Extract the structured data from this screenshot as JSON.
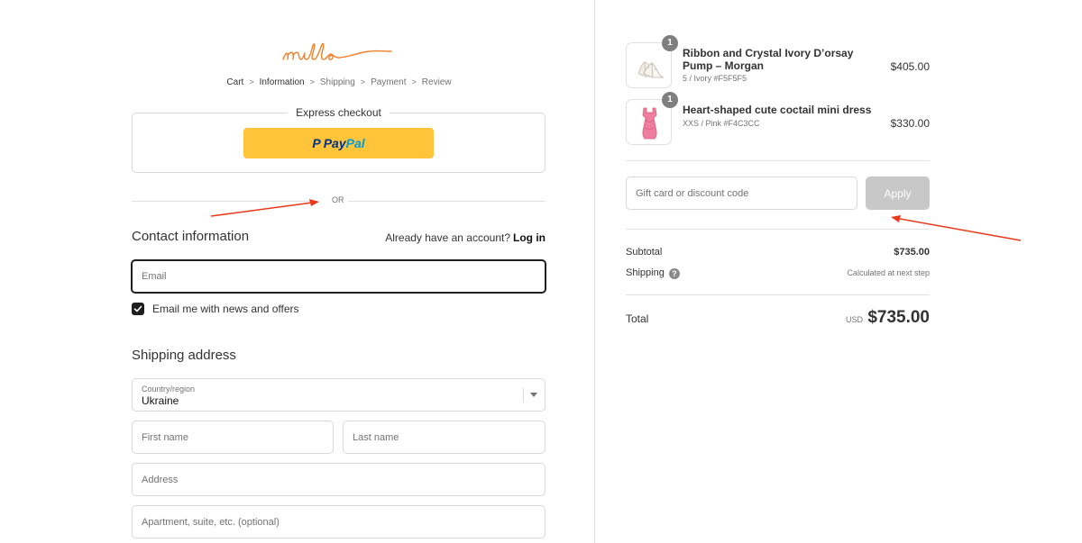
{
  "logo": {
    "text": "milla"
  },
  "breadcrumb": {
    "items": [
      "Cart",
      "Information",
      "Shipping",
      "Payment",
      "Review"
    ],
    "separator": ">"
  },
  "express": {
    "title": "Express checkout",
    "paypal": {
      "p": "P",
      "pay": "Pay",
      "pal": "Pal",
      "color": "#ffc439"
    }
  },
  "divider": {
    "text": "OR"
  },
  "contact": {
    "title": "Contact information",
    "account_prompt": "Already have an account?",
    "login_label": "Log in",
    "email_placeholder": "Email",
    "newsletter_label": "Email me with news and offers",
    "newsletter_checked": true
  },
  "shipping": {
    "title": "Shipping address",
    "country_label": "Country/region",
    "country_value": "Ukraine",
    "first_name_placeholder": "First name",
    "last_name_placeholder": "Last name",
    "address_placeholder": "Address",
    "apartment_placeholder": "Apartment, suite, etc. (optional)"
  },
  "order": {
    "items": [
      {
        "quantity": "1",
        "name": "Ribbon and Crystal Ivory D’orsay Pump – Morgan",
        "variant": "5 / Ivory #F5F5F5",
        "price": "$405.00",
        "icon": "shoe-icon"
      },
      {
        "quantity": "1",
        "name": "Heart-shaped cute coctail mini dress",
        "variant": "XXS / Pink #F4C3CC",
        "price": "$330.00",
        "icon": "dress-icon"
      }
    ],
    "discount_placeholder": "Gift card or discount code",
    "apply_label": "Apply",
    "subtotal_label": "Subtotal",
    "subtotal_value": "$735.00",
    "shipping_label": "Shipping",
    "shipping_value": "Calculated at next step",
    "total_label": "Total",
    "total_currency": "USD",
    "total_value": "$735.00"
  },
  "colors": {
    "accent_logo": "#f07f2a",
    "annotation_arrow": "#e8391b",
    "checkbox": "#1f1f1f"
  }
}
